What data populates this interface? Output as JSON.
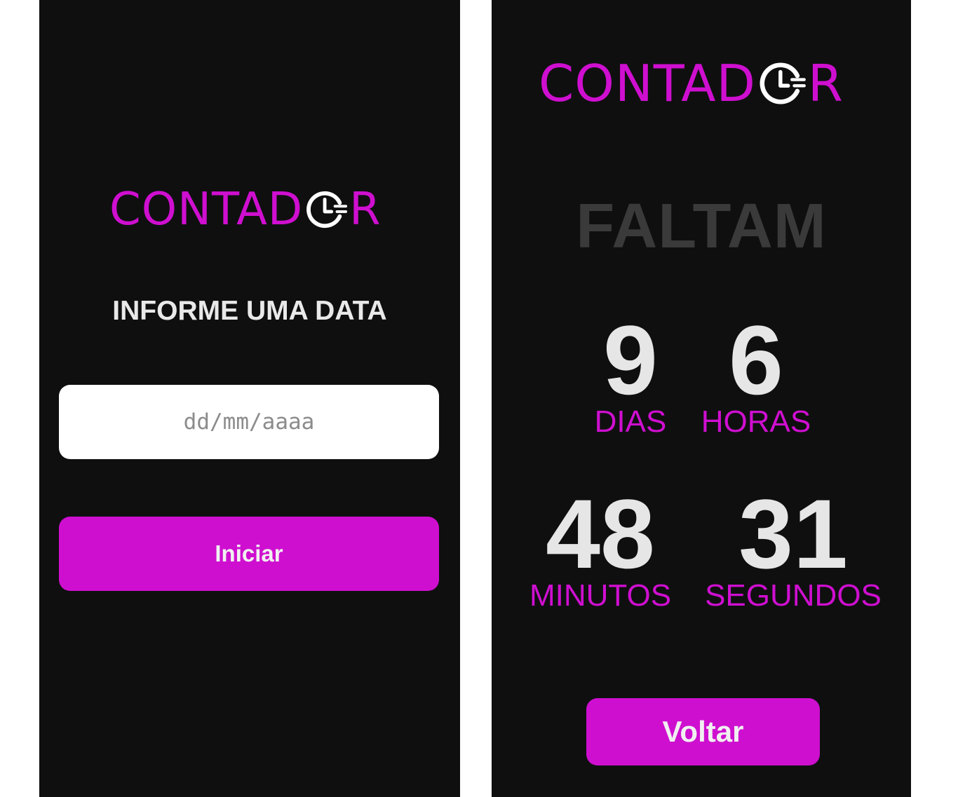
{
  "colors": {
    "accent": "#cf0fd0",
    "background": "#0f0f10",
    "number": "#e6e6e6",
    "faded": "#3a3a3a",
    "title": "#e9e9e9"
  },
  "left_screen": {
    "logo": {
      "text_before": "CONTAD",
      "icon": "clock-icon",
      "text_after": "R"
    },
    "title": "INFORME UMA DATA",
    "date_input": {
      "placeholder": "dd/mm/aaaa",
      "value": ""
    },
    "start_button": "Iniciar"
  },
  "right_screen": {
    "logo": {
      "text_before": "CONTAD",
      "icon": "clock-icon",
      "text_after": "R"
    },
    "heading": "FALTAM",
    "countdown": {
      "days": {
        "value": "9",
        "label": "DIAS"
      },
      "hours": {
        "value": "6",
        "label": "HORAS"
      },
      "minutes": {
        "value": "48",
        "label": "MINUTOS"
      },
      "seconds": {
        "value": "31",
        "label": "SEGUNDOS"
      }
    },
    "back_button": "Voltar"
  }
}
